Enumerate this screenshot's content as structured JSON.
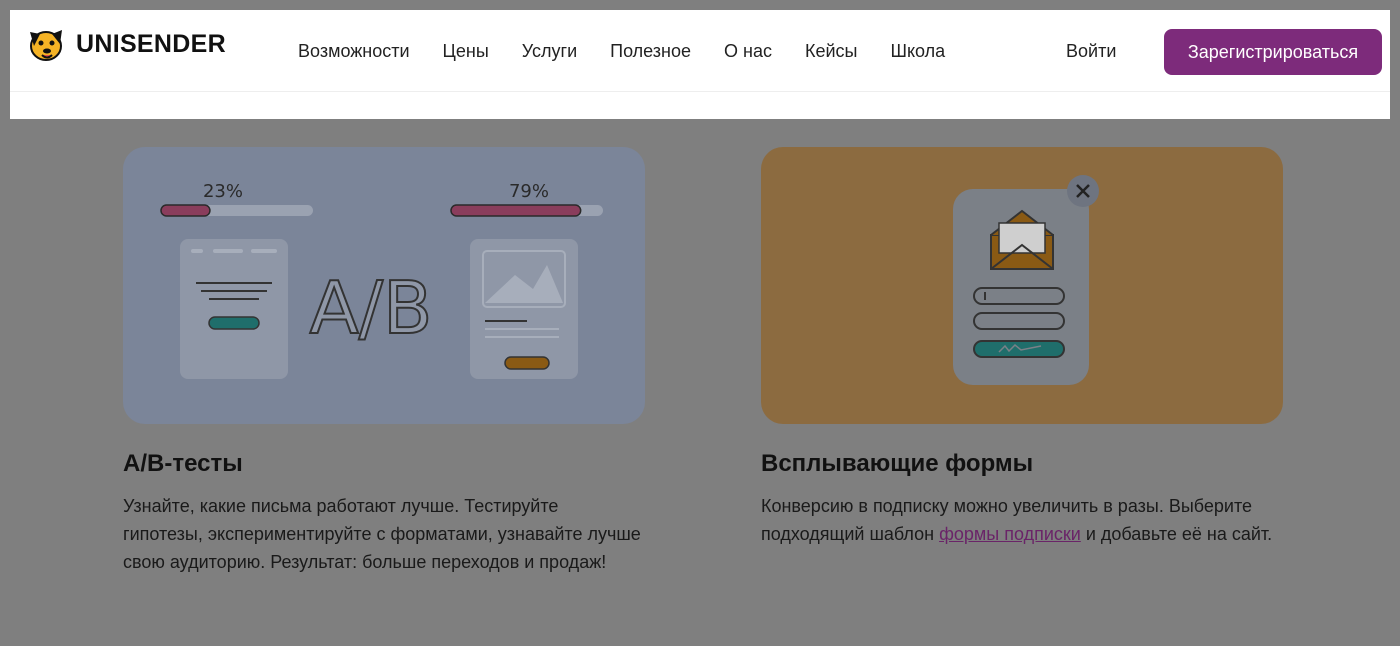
{
  "header": {
    "logo_text": "UNISENDER",
    "nav": [
      "Возможности",
      "Цены",
      "Услуги",
      "Полезное",
      "О нас",
      "Кейсы",
      "Школа"
    ],
    "login_label": "Войти",
    "signup_label": "Зарегистрироваться"
  },
  "cards": [
    {
      "title": "A/B-тесты",
      "text": "Узнайте, какие письма работают лучше. Тестируйте гипотезы, экспериментируйте с форматами, узнавайте лучше свою аудиторию. Результат: больше переходов и продаж!",
      "illustration": {
        "left_percent_label": "23%",
        "right_percent_label": "79%",
        "left_progress": 0.23,
        "right_progress": 0.79,
        "center_label": "A/B"
      }
    },
    {
      "title": "Всплывающие формы",
      "text_before_link": "Конверсию в подписку можно увеличить в разы. Выберите подходящий шаблон ",
      "link_text": "формы подписки",
      "text_after_link": " и добавьте её на сайт."
    }
  ],
  "colors": {
    "brand": "#7d2b7b",
    "overlay_bg": "#7f7f7f",
    "ab_card_bg": "#7b8599",
    "popup_card_bg": "#8c6b40"
  }
}
